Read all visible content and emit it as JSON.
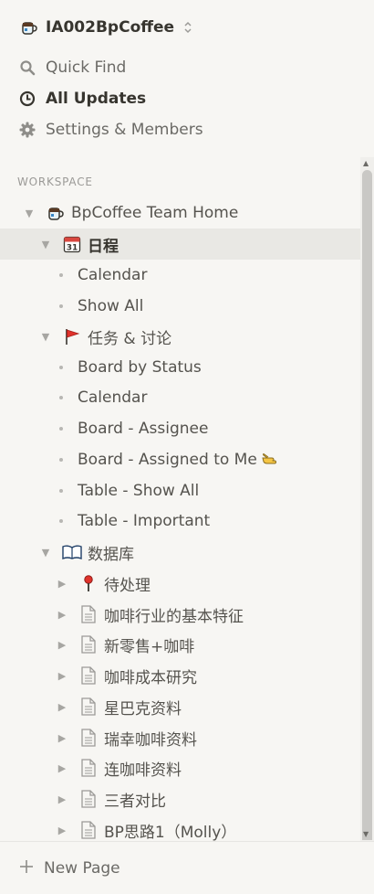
{
  "workspace": {
    "name": "IA002BpCoffee",
    "switch_icon": "coffee-mug-icon"
  },
  "top_nav": [
    {
      "label": "Quick Find",
      "icon": "search-icon"
    },
    {
      "label": "All Updates",
      "icon": "clock-icon"
    },
    {
      "label": "Settings & Members",
      "icon": "gear-icon"
    }
  ],
  "section_label": "WORKSPACE",
  "tree": [
    {
      "label": "BpCoffee Team Home",
      "icon": "coffee-mug-icon"
    },
    {
      "label": "日程",
      "icon": "calendar-icon"
    },
    {
      "label": "Calendar"
    },
    {
      "label": "Show All"
    },
    {
      "label": "任务 & 讨论",
      "icon": "red-flag-icon"
    },
    {
      "label": "Board by Status"
    },
    {
      "label": "Calendar"
    },
    {
      "label": "Board - Assignee"
    },
    {
      "label": "Board - Assigned to Me",
      "suffix_icon": "pointing-hand-icon"
    },
    {
      "label": "Table - Show All"
    },
    {
      "label": "Table - Important"
    },
    {
      "label": "数据库",
      "icon": "open-book-icon"
    },
    {
      "label": "待处理",
      "icon": "pushpin-icon"
    },
    {
      "label": "咖啡行业的基本特征",
      "icon": "document-icon"
    },
    {
      "label": "新零售+咖啡",
      "icon": "document-icon"
    },
    {
      "label": "咖啡成本研究",
      "icon": "document-icon"
    },
    {
      "label": "星巴克资料",
      "icon": "document-icon"
    },
    {
      "label": "瑞幸咖啡资料",
      "icon": "document-icon"
    },
    {
      "label": "连咖啡资料",
      "icon": "document-icon"
    },
    {
      "label": "三者对比",
      "icon": "document-icon"
    },
    {
      "label": "BP思路1（Molly）",
      "icon": "document-icon"
    }
  ],
  "new_page_label": "New Page",
  "colors": {
    "sidebar_bg": "#f7f6f3",
    "selected_bg": "#e9e8e4",
    "text": "#37352f",
    "muted": "#9b9a97"
  }
}
